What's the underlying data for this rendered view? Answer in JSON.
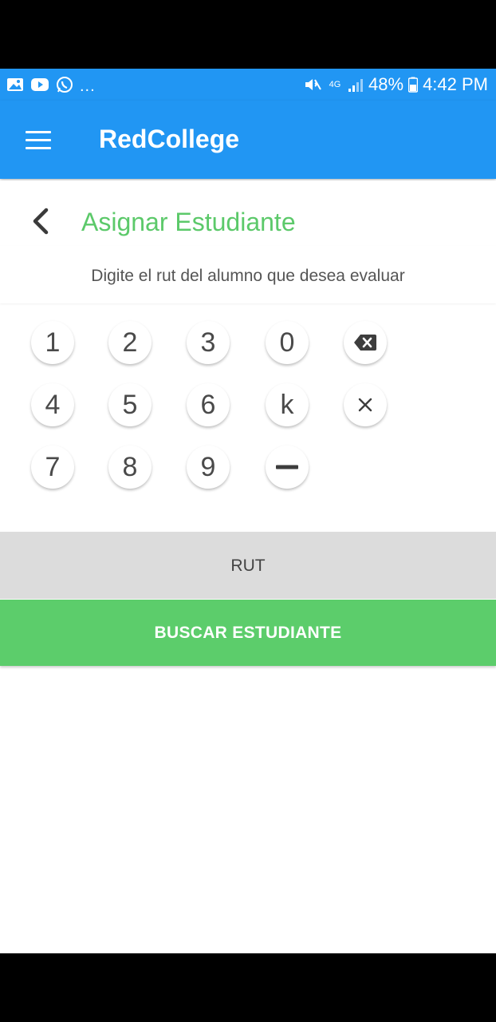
{
  "status_bar": {
    "left_icons": [
      "gallery-icon",
      "youtube-icon",
      "whatsapp-icon"
    ],
    "more": "...",
    "mute_icon": "mute-icon",
    "network": "4G",
    "battery": "48%",
    "time": "4:42 PM"
  },
  "app_bar": {
    "title": "RedCollege",
    "menu_icon": "hamburger-menu-icon",
    "color": "#2196f3"
  },
  "page": {
    "title": "Asignar Estudiante",
    "instruction": "Digite el rut del alumno que desea evaluar",
    "accent_color": "#5cc96a"
  },
  "keypad": {
    "row1": [
      "1",
      "2",
      "3",
      "0"
    ],
    "row2": [
      "4",
      "5",
      "6",
      "k"
    ],
    "row3": [
      "7",
      "8",
      "9"
    ],
    "backspace_icon": "backspace-icon",
    "clear_icon": "clear-icon",
    "dash_icon": "dash-icon"
  },
  "rut_field": {
    "placeholder": "RUT"
  },
  "search_button": {
    "label": "BUSCAR ESTUDIANTE",
    "color": "#5ccd6b"
  }
}
